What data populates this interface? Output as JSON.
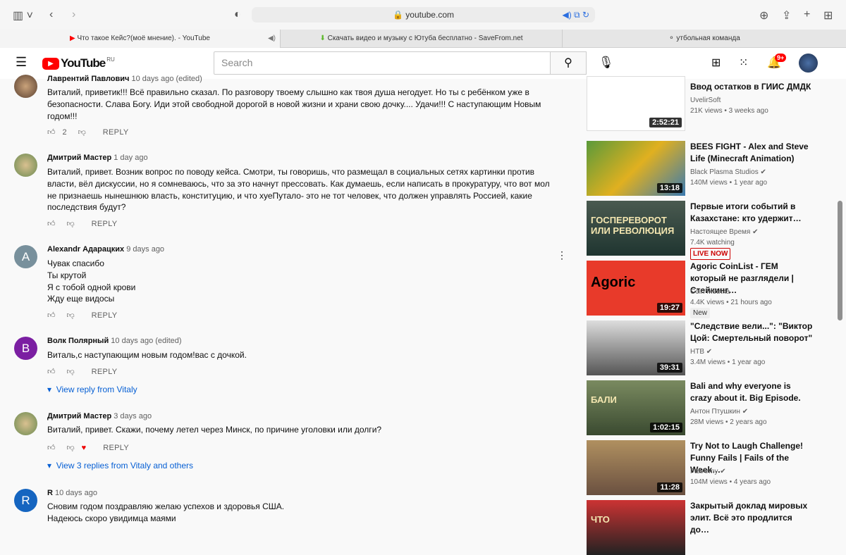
{
  "browser": {
    "url": "youtube.com",
    "tabs": [
      {
        "label": "Что такое Кейс?(моё мнение). - YouTube"
      },
      {
        "label": "Скачать видео и музыку с Ютуба бесплатно - SaveFrom.net"
      },
      {
        "label": "утбольная команда"
      }
    ]
  },
  "header": {
    "logo": "YouTube",
    "region": "RU",
    "search_placeholder": "Search",
    "notifications": "9+"
  },
  "comments": [
    {
      "author": "Лаврентий Павлович",
      "time": "10 days ago (edited)",
      "lines": [
        "Виталий, приветик!!! Всё правильно сказал. По разговору твоему слышно как твоя душа негодует. Но ты с ребёнком уже в",
        "безопасности. Слава Богу. Иди этой свободной дорогой в новой жизни и храни свою дочку.... Удачи!!! С наступающим Новым",
        "годом!!!"
      ],
      "likes": "2",
      "reply": "REPLY"
    },
    {
      "author": "Дмитрий Мастер",
      "time": "1 day ago",
      "lines": [
        "Виталий, привет. Возник вопрос по поводу кейса. Смотри, ты говоришь, что размещал в социальных сетях картинки против",
        "власти, вёл дискуссии, но я сомневаюсь, что за это начнут прессовать. Как думаешь, если написать в прокуратуру, что вот мол",
        "не признаешь нынешнюю власть, конституцию, и что хуеПутало- это не тот человек, что должен управлять Россией, какие",
        "последствия будут?"
      ],
      "likes": "",
      "reply": "REPLY"
    },
    {
      "author": "Alexandr Адарацких",
      "time": "9 days ago",
      "avatar_letter": "A",
      "avatar_color": "#78909c",
      "lines": [
        "Чувак спасибо",
        "Ты крутой",
        "Я с тобой одной крови",
        "Жду еще видосы"
      ],
      "likes": "",
      "reply": "REPLY"
    },
    {
      "author": "Волк Полярный",
      "time": "10 days ago (edited)",
      "avatar_letter": "B",
      "avatar_color": "#7b1fa2",
      "lines": [
        "Виталь,с наступающим новым годом!вас с дочкой."
      ],
      "likes": "",
      "reply": "REPLY",
      "view_replies": "View reply from Vitaly"
    },
    {
      "author": "Дмитрий Мастер",
      "time": "3 days ago",
      "lines": [
        "Виталий, привет. Скажи, почему летел через Минск, по причине уголовки или долги?"
      ],
      "likes": "",
      "reply": "REPLY",
      "view_replies": "View 3 replies from Vitaly and others"
    },
    {
      "author": "R",
      "time": "10 days ago",
      "avatar_letter": "R",
      "avatar_color": "#1565c0",
      "lines": [
        "Сновим годом поздравляю  желаю успехов и здоровья   США.",
        "Надеюсь  скоро увидимца  маями"
      ]
    }
  ],
  "videos": [
    {
      "title": "Ввод остатков в ГИИС ДМДК",
      "channel": "UvelirSoft",
      "meta": "21K views • 3 weeks ago",
      "duration": "2:52:21",
      "verified": false
    },
    {
      "title": "BEES FIGHT - Alex and Steve Life (Minecraft Animation)",
      "channel": "Black Plasma Studios",
      "meta": "140M views • 1 year ago",
      "duration": "13:18",
      "verified": true
    },
    {
      "title": "Первые итоги событий в Казахстане: кто удержит…",
      "channel": "Настоящее Время",
      "meta": "7.4K watching",
      "badge": "LIVE NOW",
      "thumb_text": "ГОСПЕРЕВОРОТ ИЛИ РЕВОЛЮЦИЯ",
      "verified": true
    },
    {
      "title": "Agoric CoinList - ГЕМ который не разглядели | Стейкинг…",
      "channel": "Coin Metrika",
      "meta": "4.4K views • 21 hours ago",
      "duration": "19:27",
      "new": "New",
      "thumb_text": "Agoric",
      "verified": false
    },
    {
      "title": "\"Следствие вели...\": \"Виктор Цой: Смертельный поворот\"",
      "channel": "НТВ",
      "meta": "3.4M views • 1 year ago",
      "duration": "39:31",
      "verified": true
    },
    {
      "title": "Bali and why everyone is crazy about it. Big Episode.",
      "channel": "Антон Птушкин",
      "meta": "28M views • 2 years ago",
      "duration": "1:02:15",
      "thumb_text": "БАЛИ",
      "verified": true
    },
    {
      "title": "Try Not to Laugh Challenge! Funny Fails | Fails of the Week…",
      "channel": "FailArmy",
      "meta": "104M views • 4 years ago",
      "duration": "11:28",
      "verified": true
    },
    {
      "title": "Закрытый доклад мировых элит. Всё это продлится до…",
      "channel": "",
      "meta": "",
      "thumb_text": "ЧТО",
      "verified": false
    }
  ]
}
